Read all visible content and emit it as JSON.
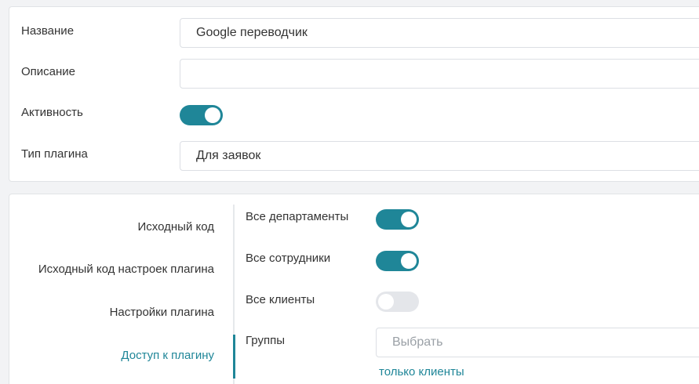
{
  "form": {
    "name_label": "Название",
    "name_value": "Google переводчик",
    "description_label": "Описание",
    "description_value": "",
    "active_label": "Активность",
    "active_on": true,
    "type_label": "Тип плагина",
    "type_value": "Для заявок"
  },
  "nav": {
    "items": [
      {
        "label": "Исходный код",
        "active": false
      },
      {
        "label": "Исходный код настроек плагина",
        "active": false
      },
      {
        "label": "Настройки плагина",
        "active": false
      },
      {
        "label": "Доступ к плагину",
        "active": true
      }
    ]
  },
  "access": {
    "all_departments_label": "Все департаменты",
    "all_departments_on": true,
    "all_employees_label": "Все сотрудники",
    "all_employees_on": true,
    "all_clients_label": "Все клиенты",
    "all_clients_on": false,
    "groups_label": "Группы",
    "groups_placeholder": "Выбрать",
    "only_clients_link": "только клиенты"
  },
  "colors": {
    "accent": "#1f8698",
    "toggle_off": "#e4e6ea",
    "border": "#dcdfe4"
  }
}
